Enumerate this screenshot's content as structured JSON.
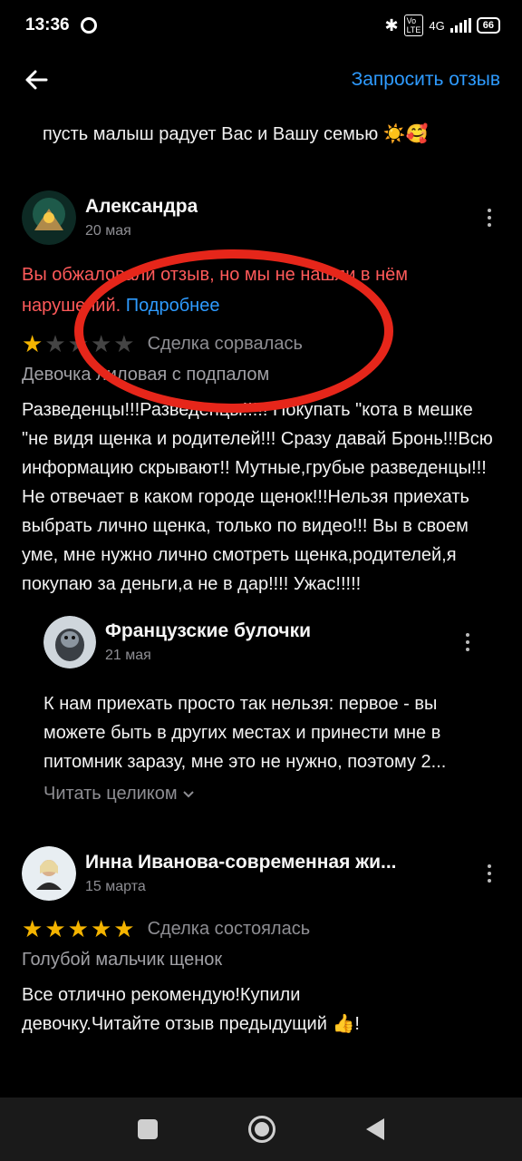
{
  "status_bar": {
    "time": "13:36",
    "network": "4G",
    "battery": "66"
  },
  "header": {
    "request_review": "Запросить отзыв"
  },
  "previous_review": {
    "text_tail": "пусть малыш радует Вас и Вашу семью ☀️🥰"
  },
  "reviews": [
    {
      "author": "Александра",
      "date": "20 мая",
      "alert_text": "Вы обжаловали отзыв, но мы не нашли в нём нарушений.",
      "alert_link": "Подробнее",
      "rating": 1,
      "deal_status": "Сделка сорвалась",
      "variant": "Девочка лиловая с подпалом",
      "text": "Разведенцы!!!Разведенцы!!!!! Покупать  \"кота в мешке \"не видя щенка и родителей!!! Сразу давай Бронь!!!Всю информацию скрывают!! Мутные,грубые разведенцы!!!Не отвечает в каком городе щенок!!!Нельзя приехать выбрать лично щенка, только по видео!!! Вы в своем уме, мне нужно лично смотреть щенка,родителей,я покупаю за деньги,а не в дар!!!! Ужас!!!!!",
      "reply": {
        "author": "Французские булочки",
        "date": "21 мая",
        "text": "К нам приехать просто так нельзя: первое - вы можете быть в других местах и принести мне в питомник заразу, мне это не нужно, поэтому 2...",
        "read_more": "Читать целиком"
      }
    },
    {
      "author": "Инна Иванова-современная жи...",
      "date": "15 марта",
      "rating": 5,
      "deal_status": "Сделка состоялась",
      "variant": "Голубой мальчик щенок",
      "text": "Все отлично рекомендую!Купили девочку.Читайте отзыв предыдущий 👍!"
    }
  ],
  "colors": {
    "accent": "#2e9bff",
    "alert": "#ff5a5a",
    "star": "#f4b400",
    "annotation": "#e6261a"
  },
  "icons": [
    "back-arrow-icon",
    "more-vert-icon",
    "chevron-down-icon",
    "star-icon",
    "bluetooth-icon",
    "signal-icon",
    "battery-icon"
  ]
}
